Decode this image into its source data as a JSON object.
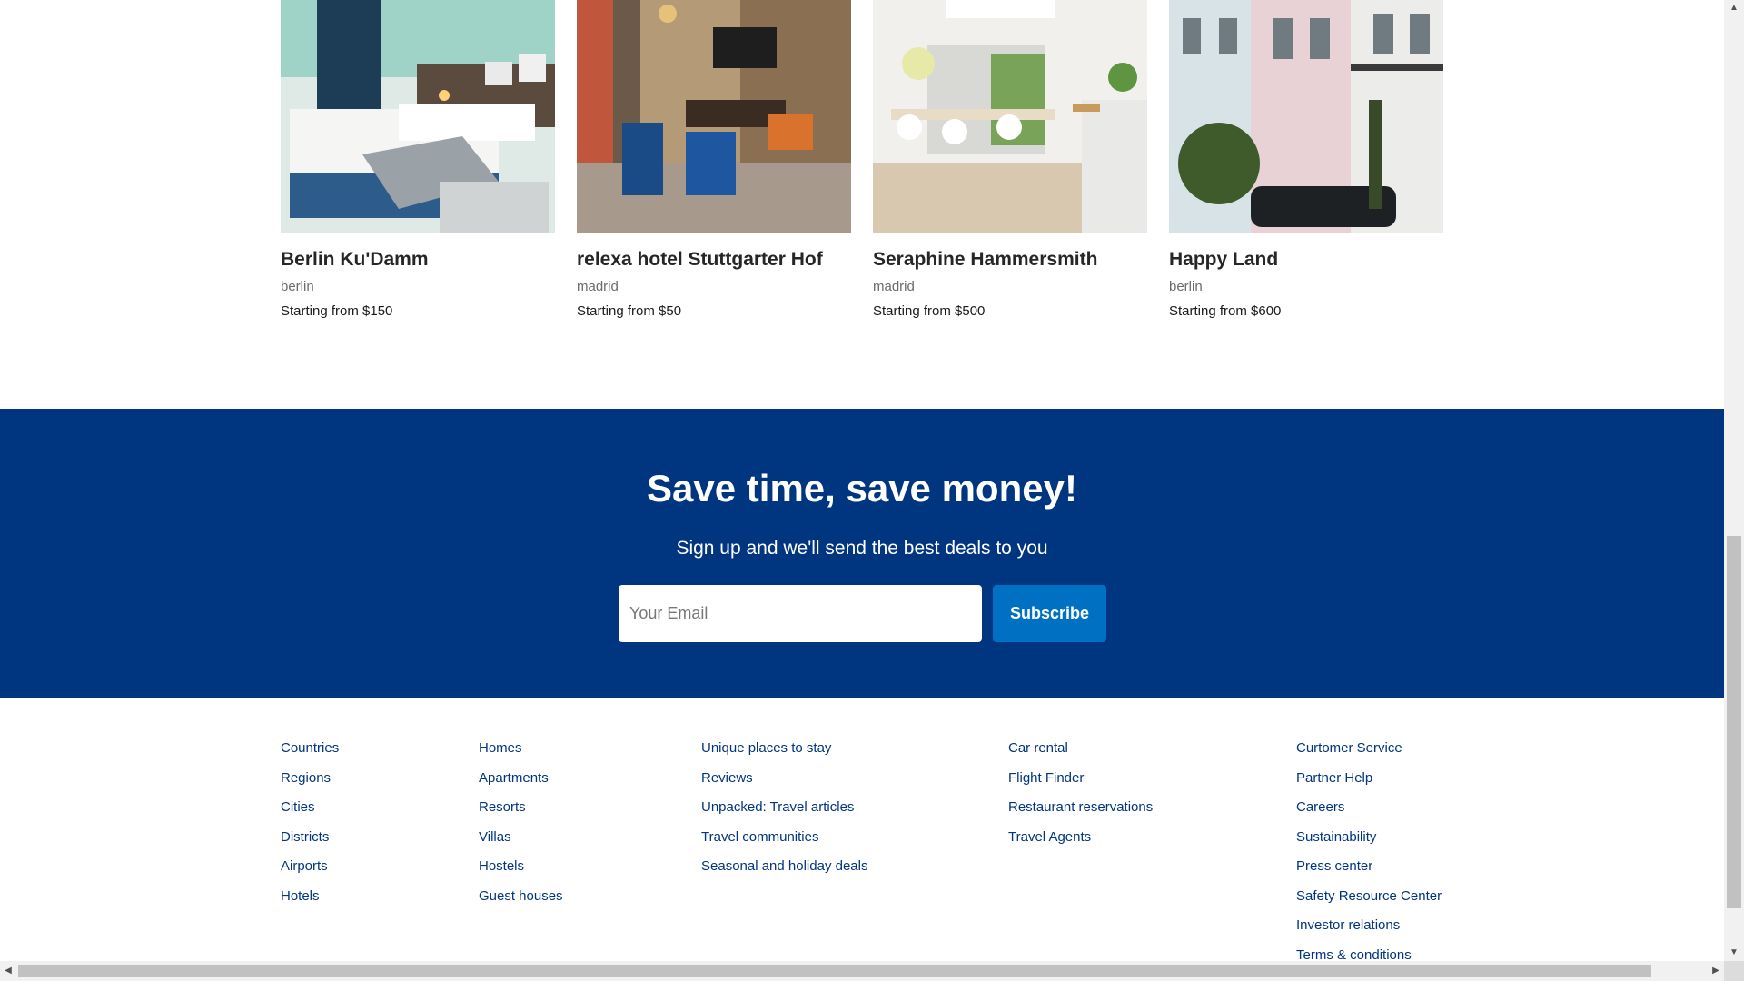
{
  "properties": [
    {
      "name": "Berlin Ku'Damm",
      "city": "berlin",
      "price": "Starting from $150"
    },
    {
      "name": "relexa hotel Stuttgarter Hof",
      "city": "madrid",
      "price": "Starting from $50"
    },
    {
      "name": "Seraphine Hammersmith",
      "city": "madrid",
      "price": "Starting from $500"
    },
    {
      "name": "Happy Land",
      "city": "berlin",
      "price": "Starting from $600"
    }
  ],
  "newsletter": {
    "title": "Save time, save money!",
    "subtitle": "Sign up and we'll send the best deals to you",
    "email_placeholder": "Your Email",
    "subscribe_label": "Subscribe",
    "background_color": "#003580",
    "button_color": "#0071c2"
  },
  "footer": {
    "columns": [
      [
        "Countries",
        "Regions",
        "Cities",
        "Districts",
        "Airports",
        "Hotels"
      ],
      [
        "Homes",
        "Apartments",
        "Resorts",
        "Villas",
        "Hostels",
        "Guest houses"
      ],
      [
        "Unique places to stay",
        "Reviews",
        "Unpacked: Travel articles",
        "Travel communities",
        "Seasonal and holiday deals"
      ],
      [
        "Car rental",
        "Flight Finder",
        "Restaurant reservations",
        "Travel Agents"
      ],
      [
        "Curtomer Service",
        "Partner Help",
        "Careers",
        "Sustainability",
        "Press center",
        "Safety Resource Center",
        "Investor relations",
        "Terms & conditions"
      ]
    ]
  },
  "icons": {
    "scroll_up": "triangle-up-icon",
    "scroll_down": "triangle-down-icon",
    "scroll_left": "triangle-left-icon",
    "scroll_right": "triangle-right-icon"
  }
}
